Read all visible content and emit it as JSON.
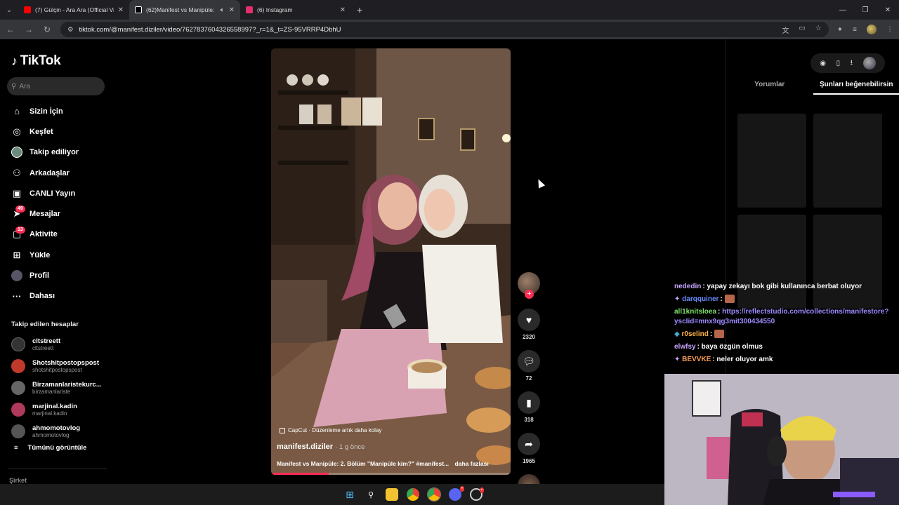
{
  "browser": {
    "tabs": [
      {
        "label": "(7) Gülçin - Ara Ara (Official Vid",
        "icon_color": "#ff0000",
        "active": false
      },
      {
        "label": "(62)Manifest vs Manipüle: 2",
        "icon_color": "#ffffff",
        "active": true
      },
      {
        "label": "(6) Instagram",
        "icon_color": "#e1306c",
        "active": false
      }
    ],
    "new_tab": "+",
    "url": "tiktok.com/@manifest.diziler/video/7627837604326558997?_r=1&_t=ZS-95VRRP4DbhU"
  },
  "tiktok": {
    "logo": "TikTok",
    "search_placeholder": "Ara",
    "nav": [
      {
        "label": "Sizin İçin",
        "icon": "home-icon",
        "glyph": "⌂"
      },
      {
        "label": "Keşfet",
        "icon": "compass-icon",
        "glyph": "◎"
      },
      {
        "label": "Takip ediliyor",
        "icon": "following-avatar-icon",
        "glyph": "●"
      },
      {
        "label": "Arkadaşlar",
        "icon": "friends-icon",
        "glyph": "⚇"
      },
      {
        "label": "CANLI Yayın",
        "icon": "live-icon",
        "glyph": "▣"
      },
      {
        "label": "Mesajlar",
        "icon": "messages-icon",
        "glyph": "➤",
        "badge": "49"
      },
      {
        "label": "Aktivite",
        "icon": "activity-icon",
        "glyph": "▢",
        "badge": "13"
      },
      {
        "label": "Yükle",
        "icon": "upload-icon",
        "glyph": "⊞"
      },
      {
        "label": "Profil",
        "icon": "profile-icon",
        "glyph": "●"
      },
      {
        "label": "Dahası",
        "icon": "more-icon",
        "glyph": "···"
      }
    ],
    "following_title": "Takip edilen hesaplar",
    "following": [
      {
        "name": "cltstreett",
        "handle": "cltstreett",
        "color": "#333333"
      },
      {
        "name": "Shotshitpostopspost",
        "handle": "shotshitpostopspost",
        "color": "#c0392b"
      },
      {
        "name": "Birzamanlaristekurc...",
        "handle": "birzamanlariste",
        "color": "#666666"
      },
      {
        "name": "marjinal.kadin",
        "handle": "marjinal.kadin",
        "color": "#b03a5b"
      },
      {
        "name": "ahmomotovlog",
        "handle": "ahmomotovlog",
        "color": "#555555"
      }
    ],
    "see_all": "Tümünü görüntüle",
    "company": "Şirket"
  },
  "video": {
    "capcut_tag": "CapCut · Düzenleme artık daha kolay",
    "author": "manifest.diziler",
    "time": "· 1 g önce",
    "caption": "Manifest vs Manipüle: 2. Bölüm \"Manipüle kim?\" #manifest...",
    "more": "daha fazlası",
    "progress": 0.24
  },
  "actions": {
    "likes": "2320",
    "comments": "72",
    "saves": "318",
    "shares": "1965"
  },
  "right_panel": {
    "tabs": [
      "Yorumlar",
      "Şunları beğenebilirsin"
    ]
  },
  "chat": [
    {
      "user": "nededin",
      "color": "#c9a6ff",
      "msg": ": yapay zekayı bok gibi kullanınca berbat oluyor",
      "badges": false
    },
    {
      "user": "darqquiner",
      "color": "#6a8cff",
      "msg": ":",
      "emote": true,
      "badges": true
    },
    {
      "user": "all1knitsloea",
      "color": "#7fe06b",
      "msg": ":",
      "link": "https://reflectstudio.com/collections/manifestore?yscIid=mnx9qg3mit300434550"
    },
    {
      "user": "r0selind",
      "color": "#ffb347",
      "msg": ":",
      "emote": true,
      "badges": true
    },
    {
      "user": "elwfsy",
      "color": "#c9a6ff",
      "msg": ": baya özgün olmus"
    },
    {
      "user": "BEVVKE",
      "color": "#ff9f5a",
      "msg": ": neler oluyor amk",
      "badges": true
    }
  ]
}
